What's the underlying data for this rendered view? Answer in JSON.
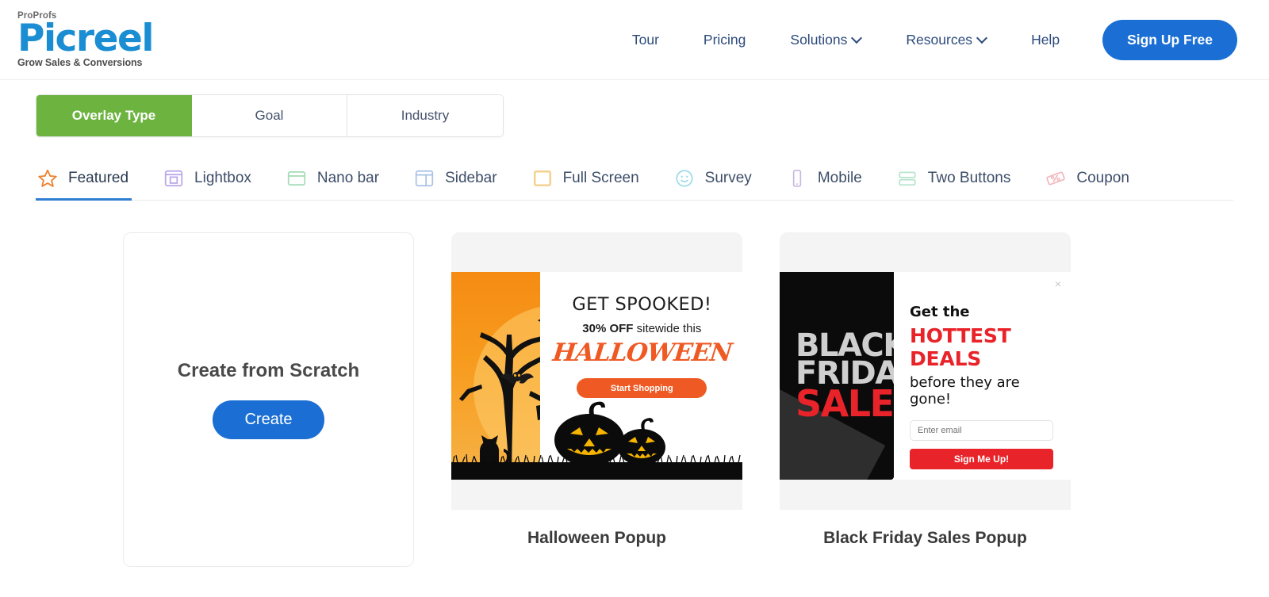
{
  "header": {
    "logo": {
      "pro": "ProProfs",
      "name": "Picreel",
      "tagline": "Grow Sales & Conversions"
    },
    "nav": [
      {
        "label": "Tour",
        "caret": false
      },
      {
        "label": "Pricing",
        "caret": false
      },
      {
        "label": "Solutions",
        "caret": true
      },
      {
        "label": "Resources",
        "caret": true
      },
      {
        "label": "Help",
        "caret": false
      }
    ],
    "signup_label": "Sign Up Free",
    "accent_blue": "#1b6fd4"
  },
  "segmented": {
    "items": [
      {
        "label": "Overlay Type",
        "active": true
      },
      {
        "label": "Goal",
        "active": false
      },
      {
        "label": "Industry",
        "active": false
      }
    ],
    "active_color": "#6cb33f"
  },
  "tabs": [
    {
      "label": "Featured",
      "icon": "star-icon",
      "color": "#ef8130",
      "active": true
    },
    {
      "label": "Lightbox",
      "icon": "lightbox-icon",
      "color": "#b9a5e8",
      "active": false
    },
    {
      "label": "Nano bar",
      "icon": "nanobar-icon",
      "color": "#a2dbb6",
      "active": false
    },
    {
      "label": "Sidebar",
      "icon": "sidebar-icon",
      "color": "#a9c2e6",
      "active": false
    },
    {
      "label": "Full Screen",
      "icon": "fullscreen-icon",
      "color": "#f4cf8a",
      "active": false
    },
    {
      "label": "Survey",
      "icon": "survey-icon",
      "color": "#9ddbe8",
      "active": false
    },
    {
      "label": "Mobile",
      "icon": "mobile-icon",
      "color": "#c7b8e0",
      "active": false
    },
    {
      "label": "Two Buttons",
      "icon": "two-buttons-icon",
      "color": "#b7e4ce",
      "active": false
    },
    {
      "label": "Coupon",
      "icon": "coupon-icon",
      "color": "#f2b8bd",
      "active": false
    }
  ],
  "cards": {
    "scratch": {
      "title": "Create from Scratch",
      "button_label": "Create"
    },
    "halloween": {
      "footer_title": "Halloween Popup",
      "headline": "GET SPOOKED!",
      "sub_bold": "30% OFF",
      "sub_rest": " sitewide this",
      "script_word": "HALLOWEEN",
      "cta_label": "Start Shopping",
      "accent": "#ef5a24"
    },
    "blackfriday": {
      "footer_title": "Black Friday Sales Popup",
      "panel_line1": "BLACK",
      "panel_line2": "FRIDAY",
      "panel_line3": "SALE",
      "headline_top": "Get the",
      "headline_red": "HOTTEST DEALS",
      "headline_bottom": "before they are gone!",
      "email_placeholder": "Enter email",
      "cta_label": "Sign Me Up!",
      "close_glyph": "×",
      "accent": "#e8232a"
    }
  }
}
